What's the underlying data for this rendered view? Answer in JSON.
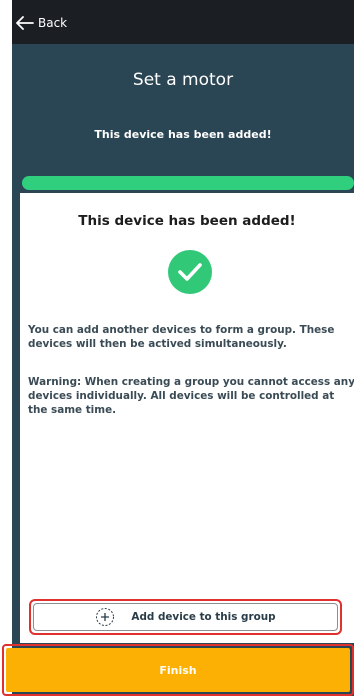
{
  "topbar": {
    "back_label": "Back",
    "back_icon": "arrow-left-icon"
  },
  "header": {
    "title": "Set a motor",
    "subtitle": "This device has been added!"
  },
  "progress": {
    "value": 1.0,
    "color": "#2fcf7e"
  },
  "card": {
    "title": "This device has been added!",
    "status_icon": "check-circle-icon",
    "paragraph1": "You can add another devices to form a group. These devices will then be actived simultaneously.",
    "paragraph2": "Warning: When creating a group you cannot access any devices individually. All devices will be controlled at the same time."
  },
  "actions": {
    "add_label": "Add device to this group",
    "add_icon": "plus-circle-dashed-icon",
    "finish_label": "Finish"
  },
  "colors": {
    "background": "#2a4553",
    "topbar": "#1b1e23",
    "accent_green": "#31c877",
    "finish": "#fbb003",
    "highlight": "#e0312e"
  }
}
